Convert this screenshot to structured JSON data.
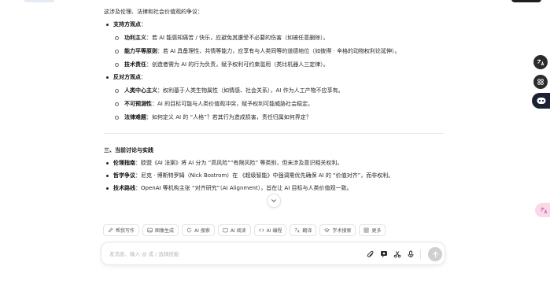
{
  "intro": "这涉及伦理、法律和社会价值观的争议：",
  "support": {
    "title": "支持方观点",
    "items": [
      {
        "label": "功利主义",
        "text": "若 AI 能感知痛苦 / 快乐，应避免其遭受不必要的伤害（如被任意删除）。"
      },
      {
        "label": "能力平等原则",
        "text": "若 AI 具备理性、共情等能力，应享有与人类同等的道德地位（如彼得 · 辛格的动物权利论延伸）。"
      },
      {
        "label": "技术责任",
        "text": "创造者需为 AI 的行为负责，赋予权利可约束滥用（类比机器人三定律）。"
      }
    ]
  },
  "oppose": {
    "title": "反对方观点",
    "items": [
      {
        "label": "人类中心主义",
        "text": "权利基于人类生物属性（如情感、社会关系），AI 作为人工产物不应享有。"
      },
      {
        "label": "不可预测性",
        "text": "AI 的目标可能与人类价值观冲突，赋予权利可能威胁社会稳定。"
      },
      {
        "label": "法律难题",
        "text": "如何定义 AI 的 “人格”？若其行为造成损害，责任归属如何界定？"
      }
    ]
  },
  "section3": {
    "heading": "三、当前讨论与实践",
    "items": [
      {
        "label": "伦理指南",
        "text": "欧盟《AI 法案》将 AI 分为 “高风险”“有限风险” 等类别，但未涉及意识相关权利。"
      },
      {
        "label": "哲学争议",
        "text": "尼克 · 博斯特罗姆（Nick Bostrom）在 《超级智能》中强调需优先确保 AI 的 “价值对齐”，而非权利。"
      },
      {
        "label": "技术路线",
        "text": "OpenAI 等机构主张 “对齐研究”（AI Alignment），旨在让 AI 目标与人类价值观一致。"
      }
    ]
  },
  "toolbar": [
    {
      "icon": "pen-icon",
      "label": "帮我写作"
    },
    {
      "icon": "image-icon",
      "label": "图像生成"
    },
    {
      "icon": "search-icon",
      "label": "AI 搜索"
    },
    {
      "icon": "book-icon",
      "label": "AI 阅读"
    },
    {
      "icon": "code-icon",
      "label": "AI 编程"
    },
    {
      "icon": "translate-icon",
      "label": "翻译"
    },
    {
      "icon": "cap-icon",
      "label": "学术搜索"
    },
    {
      "icon": "grid-icon",
      "label": "更多"
    }
  ],
  "composer": {
    "placeholder": "发消息、输入 @ 或 / 选择技能"
  },
  "colors": {
    "send_disabled": "#cfcfcf",
    "rail_dark": "#2b2b2b",
    "rail_pink": "#f7d9ea"
  }
}
